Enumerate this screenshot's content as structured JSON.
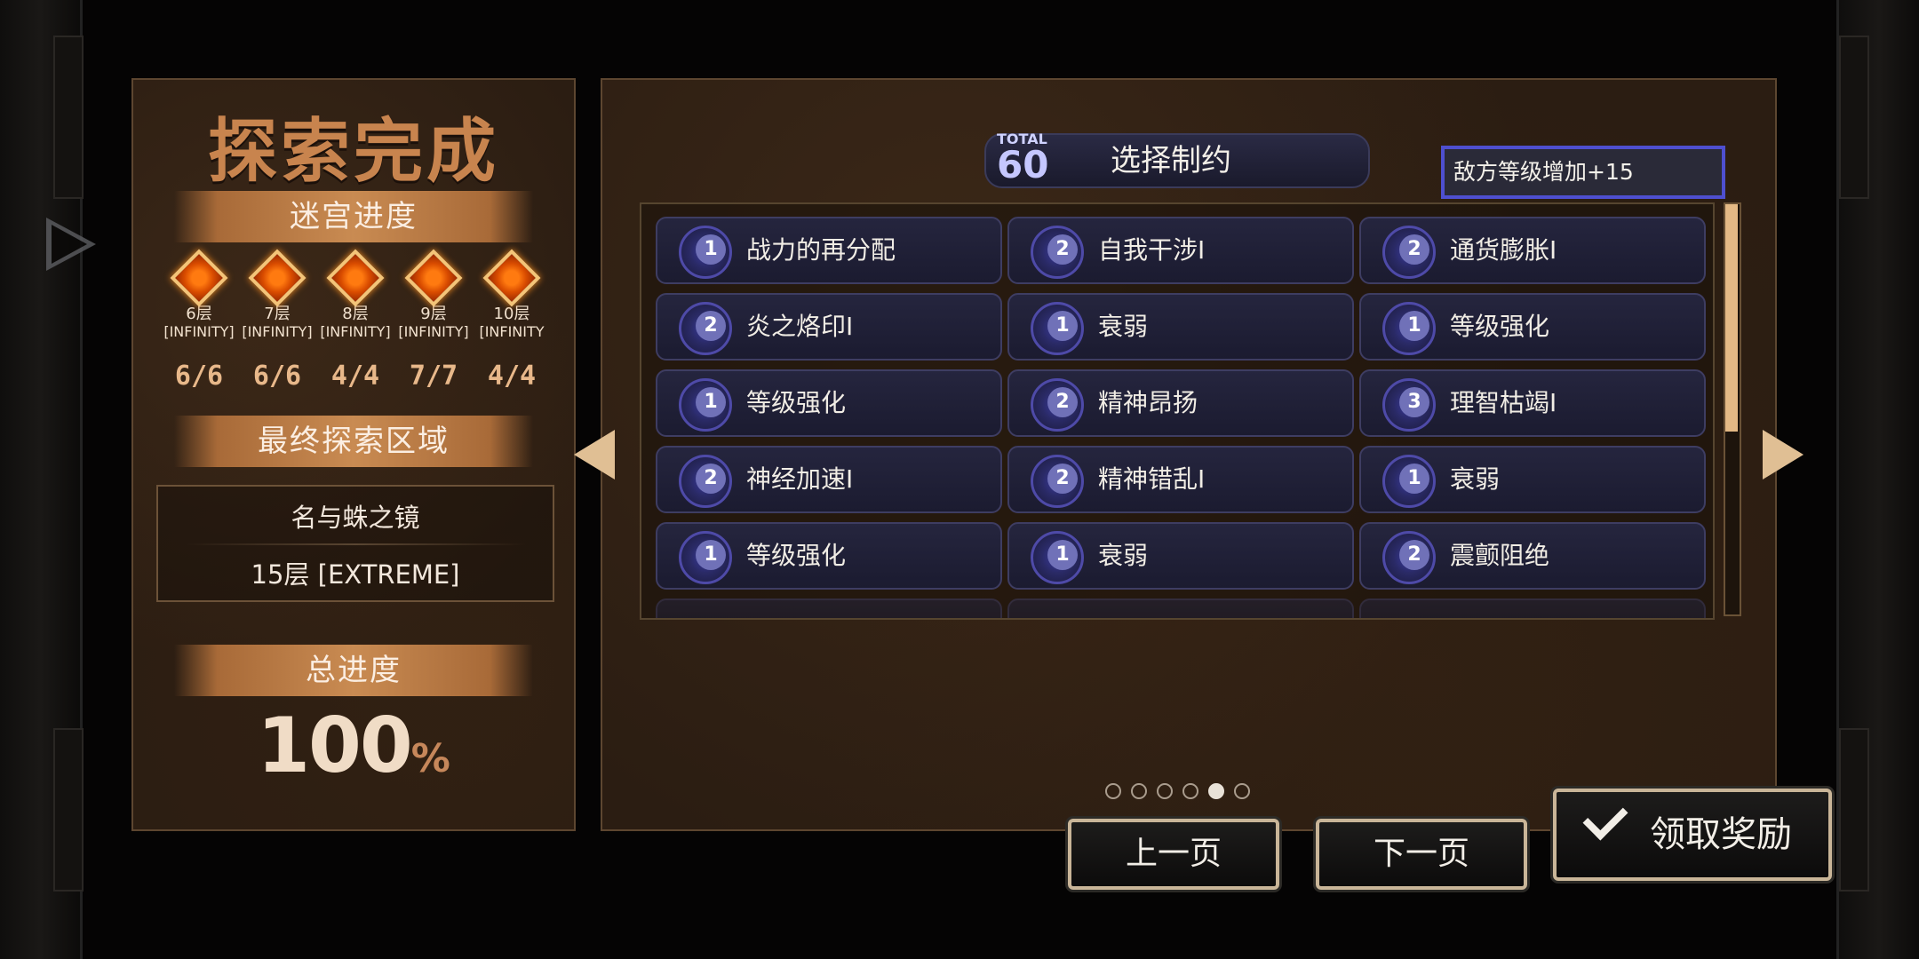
{
  "left_panel": {
    "title": "探索完成",
    "maze_progress": {
      "label": "迷宫进度",
      "floors": [
        {
          "name": "6层",
          "tier": "[INFINITY]",
          "count": "6/6"
        },
        {
          "name": "7层",
          "tier": "[INFINITY]",
          "count": "6/6"
        },
        {
          "name": "8层",
          "tier": "[INFINITY]",
          "count": "4/4"
        },
        {
          "name": "9层",
          "tier": "[INFINITY]",
          "count": "7/7"
        },
        {
          "name": "10层",
          "tier": "[INFINITY",
          "count": "4/4"
        }
      ]
    },
    "final_area": {
      "label": "最终探索区域",
      "name": "名与蛛之镜",
      "floor": "15层 [EXTREME]"
    },
    "total_progress": {
      "label": "总进度",
      "value": "100",
      "unit": "%"
    }
  },
  "right_panel": {
    "total": {
      "label": "TOTAL",
      "value": "60"
    },
    "title": "选择制约",
    "filter_text": "敌方等级增加+15",
    "constraints": [
      {
        "level": "1",
        "label": "战力的再分配"
      },
      {
        "level": "2",
        "label": "自我干涉Ⅰ"
      },
      {
        "level": "2",
        "label": "通货膨胀Ⅰ"
      },
      {
        "level": "2",
        "label": "炎之烙印Ⅰ"
      },
      {
        "level": "1",
        "label": "衰弱"
      },
      {
        "level": "1",
        "label": "等级强化"
      },
      {
        "level": "1",
        "label": "等级强化"
      },
      {
        "level": "2",
        "label": "精神昂扬"
      },
      {
        "level": "3",
        "label": "理智枯竭Ⅰ"
      },
      {
        "level": "2",
        "label": "神经加速Ⅰ"
      },
      {
        "level": "2",
        "label": "精神错乱Ⅰ"
      },
      {
        "level": "1",
        "label": "衰弱"
      },
      {
        "level": "1",
        "label": "等级强化"
      },
      {
        "level": "1",
        "label": "衰弱"
      },
      {
        "level": "2",
        "label": "震颤阻绝"
      }
    ],
    "pagination": {
      "total": 6,
      "current": 5
    }
  },
  "buttons": {
    "prev_page": "上一页",
    "next_page": "下一页",
    "claim": "领取奖励"
  },
  "icons": [
    "share-icon",
    "prev-arrow-icon",
    "next-arrow-icon",
    "check-icon"
  ]
}
